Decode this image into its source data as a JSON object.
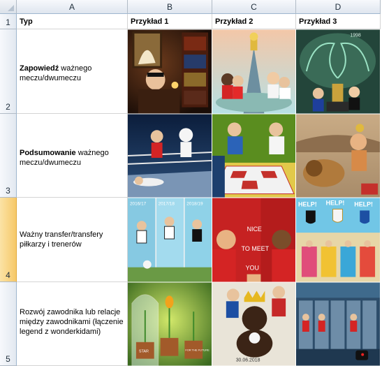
{
  "columns": [
    "A",
    "B",
    "C",
    "D"
  ],
  "rows": [
    "1",
    "2",
    "3",
    "4",
    "5"
  ],
  "header": {
    "type": "Typ",
    "example1": "Przykład 1",
    "example2": "Przykład 2",
    "example3": "Przykład 3"
  },
  "types": [
    {
      "bold": "Zapowiedź",
      "rest": " ważnego meczu/dwumeczu"
    },
    {
      "bold": "Podsumowanie",
      "rest": " ważnego meczu/dwumeczu"
    },
    {
      "bold": "",
      "rest": "Ważny transfer/transfery piłkarzy i trenerów"
    },
    {
      "bold": "",
      "rest": "Rozwój zawodnika lub relacje między zawodnikami (łączenie legend z wonderkidami)"
    }
  ],
  "image_texts": {
    "transfer_years": [
      "2016/17",
      "2017/18",
      "2018/19"
    ],
    "nice_to_meet": [
      "NICE",
      "TO MEET",
      "YOU"
    ],
    "help": [
      "HELP!",
      "HELP!",
      "HELP!"
    ],
    "year_1998": "1998",
    "date_2018": "30.06.2018",
    "flowerpots": [
      "STAR",
      "FOR THE FUTURE"
    ]
  },
  "colors": {
    "selected_row": "#f6c868",
    "header_bg": "#dfe6ef",
    "grid": "#d4d4d4"
  }
}
